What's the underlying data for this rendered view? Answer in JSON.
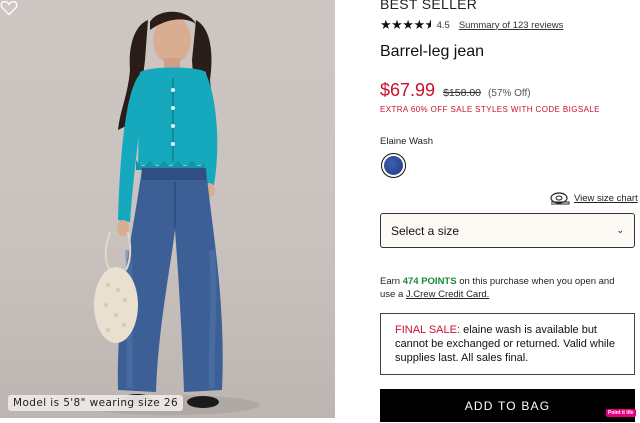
{
  "image": {
    "caption": "Model is 5'8\" wearing size 26",
    "wishlist_icon": "heart-icon"
  },
  "product": {
    "badge": "BEST SELLER",
    "rating_value": "4.5",
    "rating_stars": 4.5,
    "reviews_link": "Summary of 123 reviews",
    "title": "Barrel-leg jean",
    "sale_price": "$67.99",
    "original_price": "$158.00",
    "percent_off": "(57% Off)",
    "promo": "EXTRA 60% OFF SALE STYLES WITH CODE BIGSALE",
    "color_name": "Elaine Wash",
    "swatch_color": "#2b4a95"
  },
  "size": {
    "chart_link": "View size chart",
    "select_label": "Select a size"
  },
  "points": {
    "pre": "Earn ",
    "highlight": "474 POINTS",
    "mid": " on this purchase when you open and use a ",
    "link": "J.Crew Credit Card."
  },
  "final_sale": {
    "label": "FINAL SALE:",
    "text": " elaine wash is available but cannot be exchanged or returned. Valid while supplies last. All sales final."
  },
  "cart": {
    "add_label": "ADD TO BAG"
  },
  "corner_badge": "Point it life",
  "colors": {
    "sale_red": "#c8102e",
    "points_green": "#1a8a3a"
  }
}
